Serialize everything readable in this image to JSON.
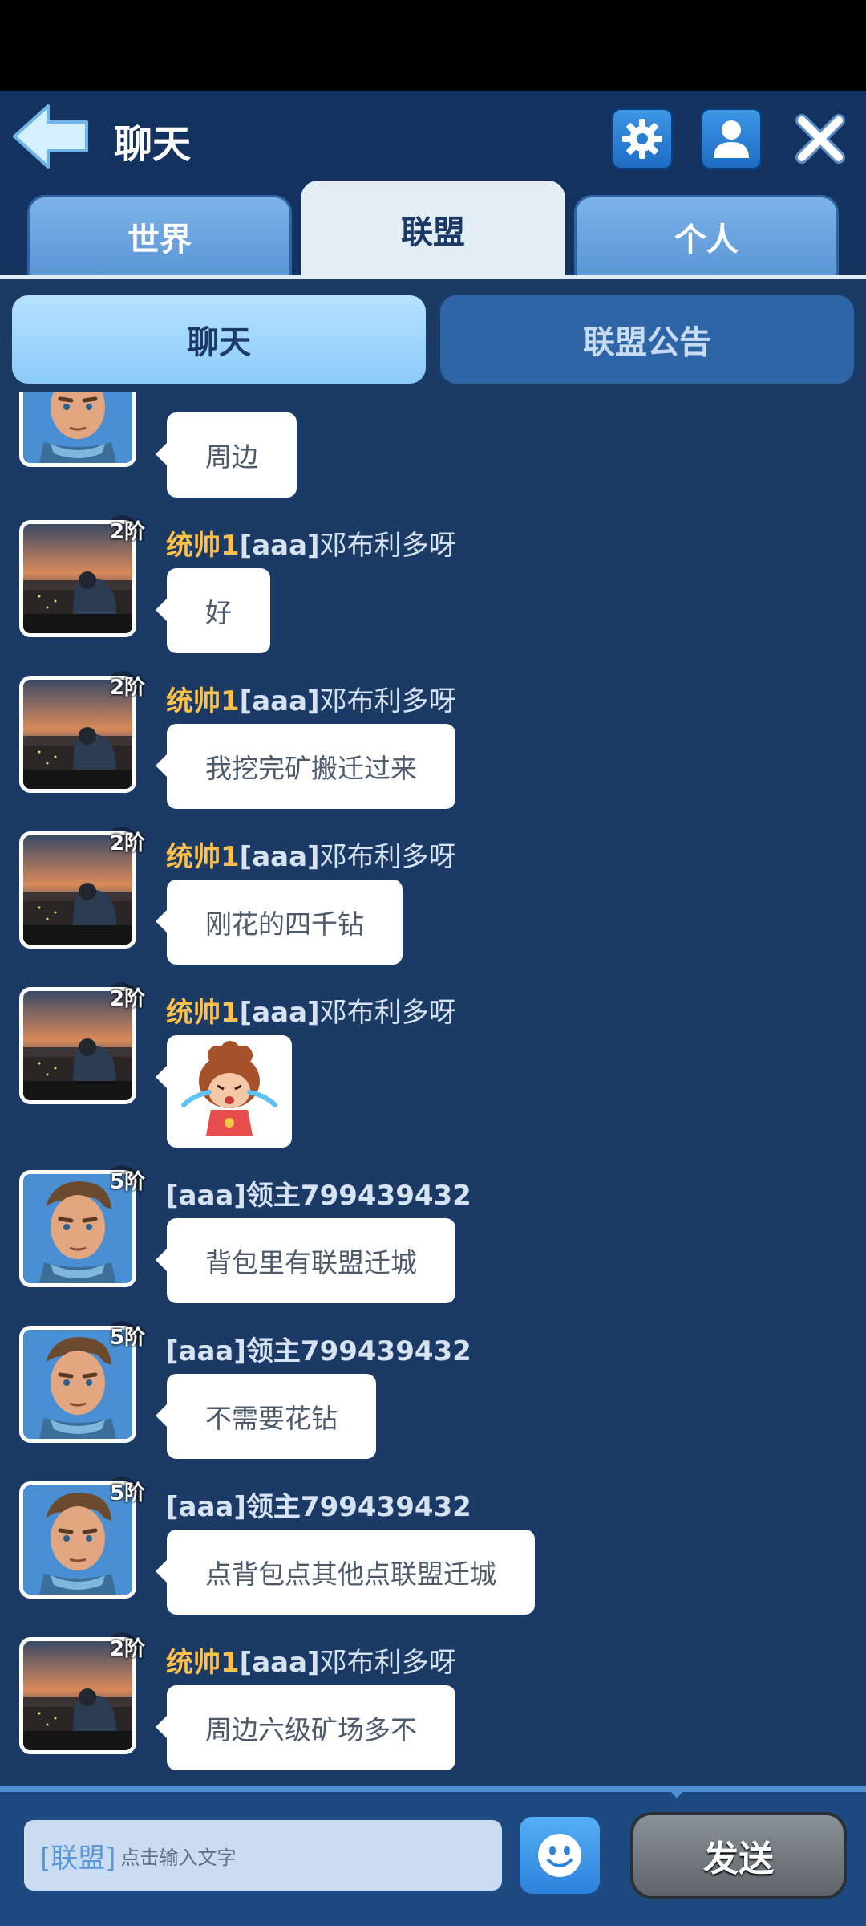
{
  "header": {
    "title": "聊天",
    "tabs": [
      {
        "label": "世界",
        "active": false
      },
      {
        "label": "联盟",
        "active": true
      },
      {
        "label": "个人",
        "active": false
      }
    ],
    "icons": {
      "back": "back-arrow-icon",
      "settings": "gear-icon",
      "profile": "user-icon",
      "close": "close-icon"
    }
  },
  "subtabs": [
    {
      "label": "聊天",
      "active": true
    },
    {
      "label": "联盟公告",
      "active": false
    }
  ],
  "messages": [
    {
      "avatar": "knight",
      "rank": "",
      "name_title": "",
      "name_tag": "",
      "name_rest": "",
      "text": "周边"
    },
    {
      "avatar": "city",
      "rank": "2阶",
      "name_title": "统帅1",
      "name_tag": "[aaa]",
      "name_rest": "邓布利多呀",
      "text": "好"
    },
    {
      "avatar": "city",
      "rank": "2阶",
      "name_title": "统帅1",
      "name_tag": "[aaa]",
      "name_rest": "邓布利多呀",
      "text": "我挖完矿搬迁过来"
    },
    {
      "avatar": "city",
      "rank": "2阶",
      "name_title": "统帅1",
      "name_tag": "[aaa]",
      "name_rest": "邓布利多呀",
      "text": "刚花的四千钻"
    },
    {
      "avatar": "city",
      "rank": "2阶",
      "name_title": "统帅1",
      "name_tag": "[aaa]",
      "name_rest": "邓布利多呀",
      "text": "",
      "sticker": "crying-girl-sticker"
    },
    {
      "avatar": "knight",
      "rank": "5阶",
      "name_title": "",
      "name_tag": "[aaa]",
      "name_rest": "领主799439432",
      "text": "背包里有联盟迁城"
    },
    {
      "avatar": "knight",
      "rank": "5阶",
      "name_title": "",
      "name_tag": "[aaa]",
      "name_rest": "领主799439432",
      "text": "不需要花钻"
    },
    {
      "avatar": "knight",
      "rank": "5阶",
      "name_title": "",
      "name_tag": "[aaa]",
      "name_rest": "领主799439432",
      "text": "点背包点其他点联盟迁城"
    },
    {
      "avatar": "city",
      "rank": "2阶",
      "name_title": "统帅1",
      "name_tag": "[aaa]",
      "name_rest": "邓布利多呀",
      "text": "周边六级矿场多不"
    }
  ],
  "input": {
    "prefix": "[联盟]",
    "placeholder": "点击输入文字"
  },
  "emoji_icon": "smiley-icon",
  "send_label": "发送",
  "colors": {
    "background": "#1b3a66",
    "header": "#14325f",
    "gold_name": "#ffc14a",
    "active_tab": "#e3edf4"
  }
}
